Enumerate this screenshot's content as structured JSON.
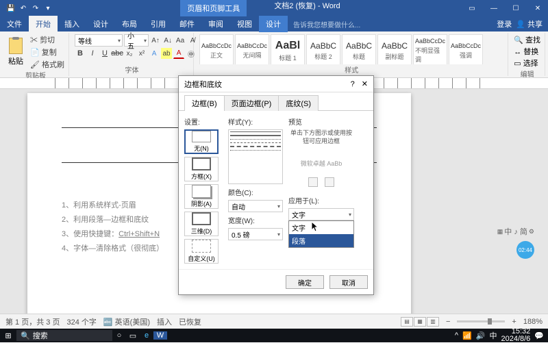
{
  "titlebar": {
    "tool_tab": "页眉和页脚工具",
    "doc_title": "文档2 (恢复) - Word"
  },
  "ribbon_tabs": {
    "file": "文件",
    "home": "开始",
    "insert": "插入",
    "design": "设计",
    "layout": "布局",
    "references": "引用",
    "mail": "邮件",
    "review": "审阅",
    "view": "视图",
    "design2": "设计",
    "tell_me": "告诉我您想要做什么...",
    "login": "登录",
    "share": "共享"
  },
  "ribbon": {
    "clipboard": {
      "paste": "粘贴",
      "cut": "剪切",
      "copy": "复制",
      "format_painter": "格式刷",
      "label": "剪贴板"
    },
    "font": {
      "name": "等线",
      "size": "小五",
      "label": "字体"
    },
    "styles_label": "样式",
    "styles": [
      {
        "preview": "AaBbCcDc",
        "name": "正文"
      },
      {
        "preview": "AaBbCcDc",
        "name": "无间隔"
      },
      {
        "preview": "AaBl",
        "name": "标题 1"
      },
      {
        "preview": "AaBbC",
        "name": "标题 2"
      },
      {
        "preview": "AaBbC",
        "name": "标题"
      },
      {
        "preview": "AaBbC",
        "name": "副标题"
      },
      {
        "preview": "AaBbCcDc",
        "name": "不明显强调"
      },
      {
        "preview": "AaBbCcDc",
        "name": "强调"
      }
    ],
    "editing": {
      "find": "查找",
      "replace": "替换",
      "select": "选择",
      "label": "编辑"
    }
  },
  "document": {
    "lines": [
      "1、利用系统样式-页眉",
      "2、利用段落—边框和底纹",
      "3、使用快捷键：",
      "4、字体—清除格式（很彻底）"
    ],
    "shortcut": "Ctrl+Shift+N"
  },
  "dialog": {
    "title": "边框和底纹",
    "tabs": {
      "border": "边框(B)",
      "page_border": "页面边框(P)",
      "shading": "底纹(S)"
    },
    "setting_label": "设置:",
    "settings": {
      "none": "无(N)",
      "box": "方框(X)",
      "shadow": "阴影(A)",
      "three_d": "三维(D)",
      "custom": "自定义(U)"
    },
    "style_label": "样式(Y):",
    "color_label": "颜色(C):",
    "color_value": "自动",
    "width_label": "宽度(W):",
    "width_value": "0.5 磅",
    "preview_label": "预览",
    "preview_hint": "单击下方图示或使用按钮可应用边框",
    "preview_sample": "微软卓越 AaBb",
    "apply_label": "应用于(L):",
    "apply_selected": "文字",
    "apply_options": {
      "text": "文字",
      "paragraph": "段落"
    },
    "ok": "确定",
    "cancel": "取消"
  },
  "statusbar": {
    "page": "第 1 页，共 3 页",
    "words": "324 个字",
    "lang": "英语(美国)",
    "insert": "插入",
    "recovered": "已恢复",
    "zoom": "188%"
  },
  "taskbar": {
    "search": "搜索",
    "ime": "中",
    "time": "15:32",
    "date": "2024/8/6"
  },
  "float": {
    "timer": "02:44",
    "ime_text": "中 ♪ 简"
  }
}
